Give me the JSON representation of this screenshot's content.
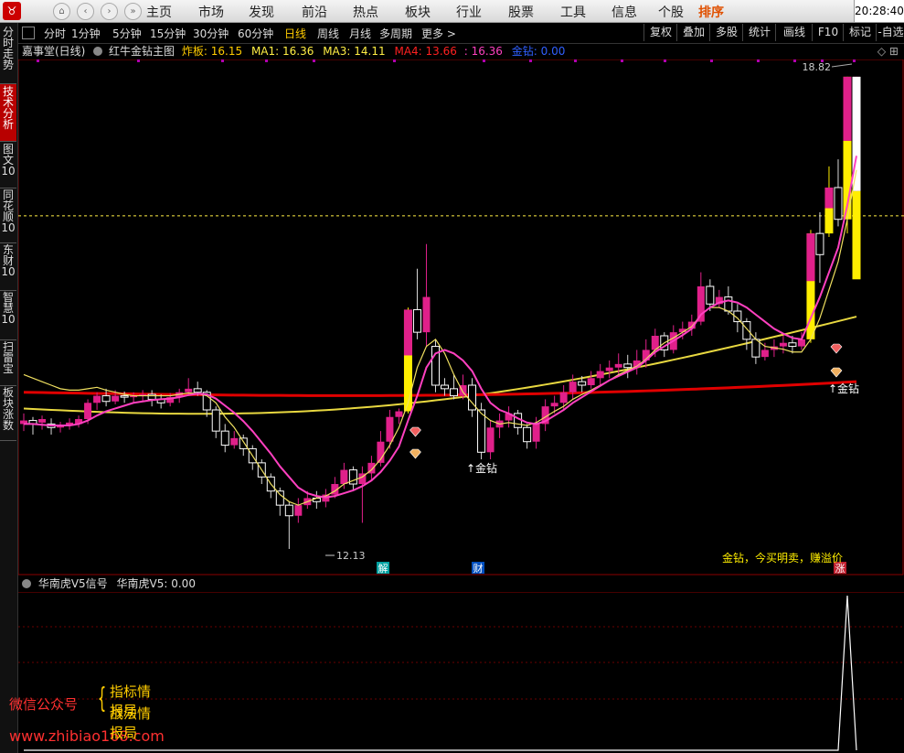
{
  "topbar": {
    "menu": [
      "主页",
      "市场",
      "发现",
      "前沿",
      "热点",
      "板块",
      "行业",
      "股票",
      "工具",
      "信息",
      "个股",
      "排序"
    ],
    "active": "排序",
    "clock": "20:28:40"
  },
  "toolbar": {
    "periods": [
      "分时",
      "1分钟",
      "5分钟",
      "15分钟",
      "30分钟",
      "60分钟",
      "日线",
      "周线",
      "月线",
      "多周期",
      "更多 >"
    ],
    "active_period": "日线",
    "buttons": [
      "复权",
      "叠加",
      "多股",
      "统计",
      "画线",
      "F10",
      "标记",
      "-自选"
    ]
  },
  "sidetabs": [
    "分时走势",
    "技术分析",
    "图文10",
    "同花顺10",
    "东财10",
    "智慧10",
    "扫雷宝",
    "板块涨数"
  ],
  "sidetab_active": "技术分析",
  "main_header": {
    "stock": "嘉事堂(日线)",
    "indicator": "红牛金钻主图",
    "zhaban_label": "炸板:",
    "zhaban_value": "16.15",
    "ma1_label": "MA1:",
    "ma1_value": "16.36",
    "ma3_label": "MA3:",
    "ma3_value": "14.11",
    "ma4_label": "MA4:",
    "ma4_value": "13.66",
    "extra_value": ": 16.36",
    "jinzuan_label": "金钻:",
    "jinzuan_value": "0.00"
  },
  "chart_labels": {
    "high_price": "18.82",
    "low_price": "12.13",
    "jinzuan_mark_1": "↑金钻",
    "jinzuan_mark_2": "↑金钻",
    "jie_badge": "解",
    "cai_badge": "财",
    "zhang_badge": "涨",
    "signal_text": "金钻，今买明卖，赚溢价"
  },
  "sub_header": {
    "indicator": "华南虎V5信号",
    "name": "华南虎V5:",
    "value": "0.00"
  },
  "watermark": {
    "line_left": "微信公众号",
    "item1": "指标情报局",
    "item2": "战法情报局",
    "url": "www.zhibiao168.com"
  },
  "colors": {
    "up": "#e0208a",
    "down": "#ffffff",
    "limit_up": "#ffee00",
    "ma_yellow": "#f0e060",
    "ma_pink": "#ff40c0",
    "ma_red": "#e00000",
    "accent": "#e05000"
  },
  "chart_data": {
    "type": "candlestick",
    "price_range": [
      12.0,
      19.0
    ],
    "candles": [
      {
        "o": 13.9,
        "c": 13.95,
        "h": 14.05,
        "l": 13.8
      },
      {
        "o": 13.95,
        "c": 13.9,
        "h": 14.0,
        "l": 13.75
      },
      {
        "o": 13.92,
        "c": 13.97,
        "h": 14.02,
        "l": 13.82
      },
      {
        "o": 13.9,
        "c": 13.85,
        "h": 13.98,
        "l": 13.75
      },
      {
        "o": 13.85,
        "c": 13.88,
        "h": 13.93,
        "l": 13.78
      },
      {
        "o": 13.88,
        "c": 13.92,
        "h": 13.98,
        "l": 13.82
      },
      {
        "o": 13.9,
        "c": 13.97,
        "h": 14.02,
        "l": 13.85
      },
      {
        "o": 13.97,
        "c": 14.2,
        "h": 14.25,
        "l": 13.9
      },
      {
        "o": 14.2,
        "c": 14.3,
        "h": 14.35,
        "l": 14.1
      },
      {
        "o": 14.3,
        "c": 14.22,
        "h": 14.4,
        "l": 14.15
      },
      {
        "o": 14.22,
        "c": 14.3,
        "h": 14.38,
        "l": 14.18
      },
      {
        "o": 14.3,
        "c": 14.28,
        "h": 14.36,
        "l": 14.2
      },
      {
        "o": 14.28,
        "c": 14.3,
        "h": 14.35,
        "l": 14.2
      },
      {
        "o": 14.3,
        "c": 14.32,
        "h": 14.38,
        "l": 14.22
      },
      {
        "o": 14.32,
        "c": 14.25,
        "h": 14.38,
        "l": 14.15
      },
      {
        "o": 14.25,
        "c": 14.2,
        "h": 14.32,
        "l": 14.12
      },
      {
        "o": 14.2,
        "c": 14.28,
        "h": 14.34,
        "l": 14.15
      },
      {
        "o": 14.28,
        "c": 14.35,
        "h": 14.4,
        "l": 14.2
      },
      {
        "o": 14.35,
        "c": 14.4,
        "h": 14.55,
        "l": 14.3
      },
      {
        "o": 14.4,
        "c": 14.35,
        "h": 14.5,
        "l": 14.3
      },
      {
        "o": 14.35,
        "c": 14.1,
        "h": 14.38,
        "l": 14.0
      },
      {
        "o": 14.1,
        "c": 13.8,
        "h": 14.15,
        "l": 13.7
      },
      {
        "o": 13.8,
        "c": 13.6,
        "h": 13.9,
        "l": 13.5
      },
      {
        "o": 13.6,
        "c": 13.7,
        "h": 13.8,
        "l": 13.55
      },
      {
        "o": 13.7,
        "c": 13.55,
        "h": 13.75,
        "l": 13.45
      },
      {
        "o": 13.55,
        "c": 13.35,
        "h": 13.6,
        "l": 13.25
      },
      {
        "o": 13.35,
        "c": 13.15,
        "h": 13.4,
        "l": 13.05
      },
      {
        "o": 13.15,
        "c": 12.95,
        "h": 13.2,
        "l": 12.85
      },
      {
        "o": 12.95,
        "c": 12.75,
        "h": 13.0,
        "l": 12.6
      },
      {
        "o": 12.75,
        "c": 12.6,
        "h": 12.8,
        "l": 12.13
      },
      {
        "o": 12.6,
        "c": 12.75,
        "h": 12.85,
        "l": 12.5
      },
      {
        "o": 12.75,
        "c": 12.85,
        "h": 12.95,
        "l": 12.7
      },
      {
        "o": 12.85,
        "c": 12.8,
        "h": 12.95,
        "l": 12.7
      },
      {
        "o": 12.8,
        "c": 12.9,
        "h": 12.98,
        "l": 12.72
      },
      {
        "o": 12.9,
        "c": 13.05,
        "h": 13.15,
        "l": 12.85
      },
      {
        "o": 13.05,
        "c": 13.25,
        "h": 13.35,
        "l": 12.98
      },
      {
        "o": 13.25,
        "c": 13.05,
        "h": 13.3,
        "l": 12.95
      },
      {
        "o": 13.05,
        "c": 13.2,
        "h": 13.3,
        "l": 12.5
      },
      {
        "o": 13.2,
        "c": 13.35,
        "h": 13.45,
        "l": 13.1
      },
      {
        "o": 13.35,
        "c": 13.65,
        "h": 13.8,
        "l": 13.3
      },
      {
        "o": 13.65,
        "c": 14.0,
        "h": 14.1,
        "l": 13.55
      },
      {
        "o": 14.0,
        "c": 14.08,
        "h": 14.12,
        "l": 13.9
      },
      {
        "o": 14.08,
        "c": 15.52,
        "h": 15.55,
        "l": 14.05
      },
      {
        "o": 15.52,
        "c": 15.2,
        "h": 16.1,
        "l": 15.1
      },
      {
        "o": 15.2,
        "c": 15.7,
        "h": 16.45,
        "l": 15.0
      },
      {
        "o": 15.0,
        "c": 14.45,
        "h": 15.1,
        "l": 14.35
      },
      {
        "o": 14.45,
        "c": 14.4,
        "h": 14.55,
        "l": 14.3
      },
      {
        "o": 14.4,
        "c": 14.3,
        "h": 14.6,
        "l": 14.25
      },
      {
        "o": 14.3,
        "c": 14.45,
        "h": 14.6,
        "l": 14.25
      },
      {
        "o": 14.45,
        "c": 14.1,
        "h": 14.55,
        "l": 14.0
      },
      {
        "o": 14.1,
        "c": 13.5,
        "h": 14.2,
        "l": 13.4
      },
      {
        "o": 13.5,
        "c": 13.85,
        "h": 13.95,
        "l": 13.4
      },
      {
        "o": 13.85,
        "c": 13.95,
        "h": 14.05,
        "l": 13.7
      },
      {
        "o": 13.95,
        "c": 14.05,
        "h": 14.15,
        "l": 13.85
      },
      {
        "o": 14.05,
        "c": 13.85,
        "h": 14.1,
        "l": 13.75
      },
      {
        "o": 13.85,
        "c": 13.65,
        "h": 13.9,
        "l": 13.55
      },
      {
        "o": 13.65,
        "c": 13.9,
        "h": 14.0,
        "l": 13.55
      },
      {
        "o": 13.9,
        "c": 14.15,
        "h": 14.25,
        "l": 13.8
      },
      {
        "o": 14.15,
        "c": 14.2,
        "h": 14.3,
        "l": 14.05
      },
      {
        "o": 14.2,
        "c": 14.35,
        "h": 14.45,
        "l": 14.1
      },
      {
        "o": 14.35,
        "c": 14.5,
        "h": 14.6,
        "l": 14.25
      },
      {
        "o": 14.5,
        "c": 14.45,
        "h": 14.58,
        "l": 14.35
      },
      {
        "o": 14.45,
        "c": 14.55,
        "h": 14.65,
        "l": 14.4
      },
      {
        "o": 14.55,
        "c": 14.65,
        "h": 14.75,
        "l": 14.45
      },
      {
        "o": 14.65,
        "c": 14.7,
        "h": 14.8,
        "l": 14.55
      },
      {
        "o": 14.7,
        "c": 14.75,
        "h": 14.9,
        "l": 14.6
      },
      {
        "o": 14.75,
        "c": 14.7,
        "h": 14.88,
        "l": 14.55
      },
      {
        "o": 14.7,
        "c": 14.8,
        "h": 14.95,
        "l": 14.6
      },
      {
        "o": 14.8,
        "c": 14.95,
        "h": 15.1,
        "l": 14.7
      },
      {
        "o": 14.95,
        "c": 15.15,
        "h": 15.25,
        "l": 14.85
      },
      {
        "o": 15.15,
        "c": 14.95,
        "h": 15.2,
        "l": 14.85
      },
      {
        "o": 14.95,
        "c": 15.2,
        "h": 15.3,
        "l": 14.9
      },
      {
        "o": 15.2,
        "c": 15.25,
        "h": 15.35,
        "l": 15.1
      },
      {
        "o": 15.25,
        "c": 15.35,
        "h": 15.45,
        "l": 15.15
      },
      {
        "o": 15.35,
        "c": 15.85,
        "h": 16.05,
        "l": 15.3
      },
      {
        "o": 15.85,
        "c": 15.6,
        "h": 15.95,
        "l": 15.5
      },
      {
        "o": 15.6,
        "c": 15.7,
        "h": 15.8,
        "l": 15.55
      },
      {
        "o": 15.7,
        "c": 15.5,
        "h": 15.85,
        "l": 15.45
      },
      {
        "o": 15.5,
        "c": 15.35,
        "h": 15.6,
        "l": 15.2
      },
      {
        "o": 15.35,
        "c": 15.1,
        "h": 15.4,
        "l": 14.95
      },
      {
        "o": 15.1,
        "c": 14.85,
        "h": 15.2,
        "l": 14.75
      },
      {
        "o": 14.85,
        "c": 14.95,
        "h": 15.05,
        "l": 14.8
      },
      {
        "o": 14.95,
        "c": 15.0,
        "h": 15.1,
        "l": 14.85
      },
      {
        "o": 15.0,
        "c": 15.05,
        "h": 15.15,
        "l": 14.9
      },
      {
        "o": 15.05,
        "c": 15.0,
        "h": 15.15,
        "l": 14.9
      },
      {
        "o": 15.0,
        "c": 15.1,
        "h": 15.2,
        "l": 14.95
      },
      {
        "o": 15.1,
        "c": 16.6,
        "h": 16.65,
        "l": 15.05
      },
      {
        "o": 16.6,
        "c": 16.3,
        "h": 16.9,
        "l": 15.9
      },
      {
        "o": 16.6,
        "c": 17.25,
        "h": 17.55,
        "l": 16.55
      },
      {
        "o": 17.25,
        "c": 16.8,
        "h": 17.65,
        "l": 16.7
      },
      {
        "o": 16.8,
        "c": 18.82,
        "h": 18.82,
        "l": 16.6
      },
      {
        "o": 18.82,
        "c": 18.82,
        "h": 18.82,
        "l": 17.1
      }
    ],
    "limit_up_days": [
      42,
      86,
      88,
      90
    ],
    "ma_yellow": [
      14.6,
      14.55,
      14.5,
      14.45,
      14.4,
      14.38,
      14.38,
      14.4,
      14.42,
      14.38,
      14.35,
      14.32,
      14.3,
      14.3,
      14.3,
      14.3,
      14.3,
      14.32,
      14.34,
      14.33,
      14.3,
      14.2,
      14.0,
      13.85,
      13.65,
      13.45,
      13.25,
      13.05,
      12.9,
      12.8,
      12.75,
      12.8,
      12.85,
      12.88,
      12.95,
      13.05,
      13.1,
      13.15,
      13.25,
      13.4,
      13.6,
      13.85,
      14.2,
      14.7,
      15.0,
      15.1,
      14.9,
      14.6,
      14.35,
      14.2,
      14.05,
      13.95,
      13.9,
      13.92,
      13.9,
      13.88,
      13.92,
      14.0,
      14.08,
      14.15,
      14.25,
      14.32,
      14.38,
      14.45,
      14.52,
      14.6,
      14.66,
      14.72,
      14.82,
      14.95,
      15.05,
      15.12,
      15.2,
      15.28,
      15.45,
      15.55,
      15.55,
      15.5,
      15.4,
      15.25,
      15.1,
      15.0,
      14.98,
      14.96,
      14.92,
      14.92,
      15.1,
      15.4,
      15.8,
      16.2,
      16.8,
      17.5
    ],
    "ma_pink": [
      13.9,
      13.9,
      13.89,
      13.88,
      13.88,
      13.88,
      13.9,
      13.95,
      14.02,
      14.08,
      14.12,
      14.16,
      14.2,
      14.22,
      14.24,
      14.25,
      14.26,
      14.28,
      14.31,
      14.33,
      14.32,
      14.26,
      14.16,
      14.06,
      13.94,
      13.8,
      13.64,
      13.48,
      13.3,
      13.15,
      13.0,
      12.92,
      12.88,
      12.86,
      12.88,
      12.92,
      12.96,
      13.02,
      13.1,
      13.22,
      13.38,
      13.58,
      13.95,
      14.3,
      14.7,
      14.9,
      14.95,
      14.9,
      14.8,
      14.65,
      14.4,
      14.2,
      14.1,
      14.05,
      13.98,
      13.92,
      13.9,
      13.94,
      14.02,
      14.1,
      14.2,
      14.28,
      14.36,
      14.44,
      14.52,
      14.58,
      14.64,
      14.7,
      14.8,
      14.92,
      15.0,
      15.08,
      15.16,
      15.25,
      15.45,
      15.55,
      15.62,
      15.65,
      15.62,
      15.55,
      15.45,
      15.35,
      15.25,
      15.18,
      15.12,
      15.1,
      15.4,
      15.7,
      16.05,
      16.4,
      17.0,
      17.7
    ],
    "ma_red_start": 14.35,
    "ma_red_end": 14.5,
    "ma_gray_start": 14.12,
    "ma_gray_end": 15.3,
    "dashed_level": 16.85,
    "subchart": {
      "type": "line",
      "values": "zero except a single spike at the last-but-one bar",
      "spike_index": 90,
      "spike_value": 1.0
    }
  }
}
